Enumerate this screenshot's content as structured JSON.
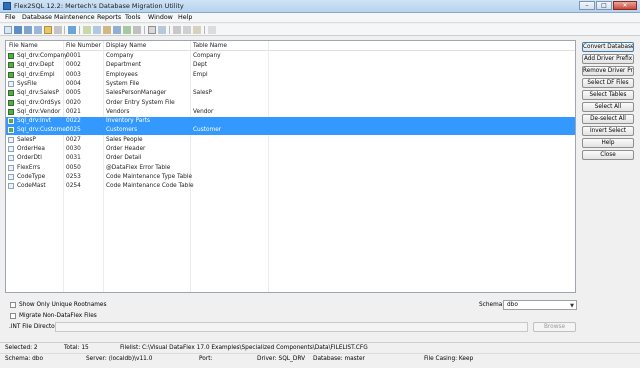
{
  "window": {
    "title": "Flex2SQL 12.2: Mertech's Database Migration Utility",
    "min": "–",
    "max": "□",
    "close": "✕"
  },
  "menu": [
    "File",
    "Database",
    "Maintenence",
    "Reports",
    "Tools",
    "Window",
    "Help"
  ],
  "columns": [
    "File Name",
    "File Number",
    "Display Name",
    "Table Name"
  ],
  "rows": [
    {
      "file": "Sql_drv:Company",
      "num": "0001",
      "display": "Company",
      "table": "Company",
      "icon": "db-table-icon",
      "selected": false
    },
    {
      "file": "Sql_drv:Dept",
      "num": "0002",
      "display": "Department",
      "table": "Dept",
      "icon": "db-table-icon",
      "selected": false
    },
    {
      "file": "Sql_drv:Empl",
      "num": "0003",
      "display": "Employees",
      "table": "Empl",
      "icon": "db-table-icon",
      "selected": false
    },
    {
      "file": "SysFile",
      "num": "0004",
      "display": "System File",
      "table": "",
      "icon": "dataflex-file-icon",
      "selected": false
    },
    {
      "file": "Sql_drv:SalesP",
      "num": "0005",
      "display": "SalesPersonManager",
      "table": "SalesP",
      "icon": "db-table-icon",
      "selected": false
    },
    {
      "file": "Sql_drv:OrdSys",
      "num": "0020",
      "display": "Order Entry System File",
      "table": "",
      "icon": "db-table-icon",
      "selected": false
    },
    {
      "file": "Sql_drv:Vendor",
      "num": "0021",
      "display": "Vendors",
      "table": "Vendor",
      "icon": "db-table-icon",
      "selected": false
    },
    {
      "file": "Sql_drv:Invt",
      "num": "0022",
      "display": "Inventory Parts",
      "table": "",
      "icon": "db-table-icon",
      "selected": true
    },
    {
      "file": "Sql_drv:Customer",
      "num": "0025",
      "display": "Customers",
      "table": "Customer",
      "icon": "db-table-icon",
      "selected": true
    },
    {
      "file": "SalesP",
      "num": "0027",
      "display": "Sales People",
      "table": "",
      "icon": "dataflex-file-icon",
      "selected": false
    },
    {
      "file": "OrderHea",
      "num": "0030",
      "display": "Order Header",
      "table": "",
      "icon": "dataflex-file-icon",
      "selected": false
    },
    {
      "file": "OrderDtl",
      "num": "0031",
      "display": "Order Detail",
      "table": "",
      "icon": "dataflex-file-icon",
      "selected": false
    },
    {
      "file": "FlexErrs",
      "num": "0050",
      "display": "@DataFlex Error Table",
      "table": "",
      "icon": "dataflex-file-icon",
      "selected": false
    },
    {
      "file": "CodeType",
      "num": "0253",
      "display": "Code Maintenance Type Table",
      "table": "",
      "icon": "dataflex-file-icon",
      "selected": false
    },
    {
      "file": "CodeMast",
      "num": "0254",
      "display": "Code Maintenance Code Table",
      "table": "",
      "icon": "dataflex-file-icon",
      "selected": false
    }
  ],
  "buttons": [
    "Convert Database",
    "Add Driver Prefix",
    "Remove Driver Prefix",
    "Select DF Files",
    "Select Tables",
    "Select All",
    "De-select All",
    "Invert Select",
    "Help",
    "Close"
  ],
  "options": {
    "unique_rootnames": "Show Only Unique Rootnames",
    "migrate_non_dataflex": "Migrate Non-DataFlex Files",
    "schema_label": "Schema:",
    "schema_value": "dbo",
    "int_dir_label": ".INT File Directory",
    "int_dir_value": "",
    "browse": "Browse"
  },
  "status": {
    "selected": "Selected: 2",
    "total": "Total: 15",
    "filelist": "Filelist: C:\\Visual DataFlex 17.0 Examples\\Specialized Components\\Data\\FILELIST.CFG",
    "schema": "Schema: dbo",
    "server": "Server: (localdb)\\v11.0",
    "port": "Port:",
    "driver": "Driver: SQL_DRV",
    "database": "Database: master",
    "casing": "File Casing: Keep"
  }
}
